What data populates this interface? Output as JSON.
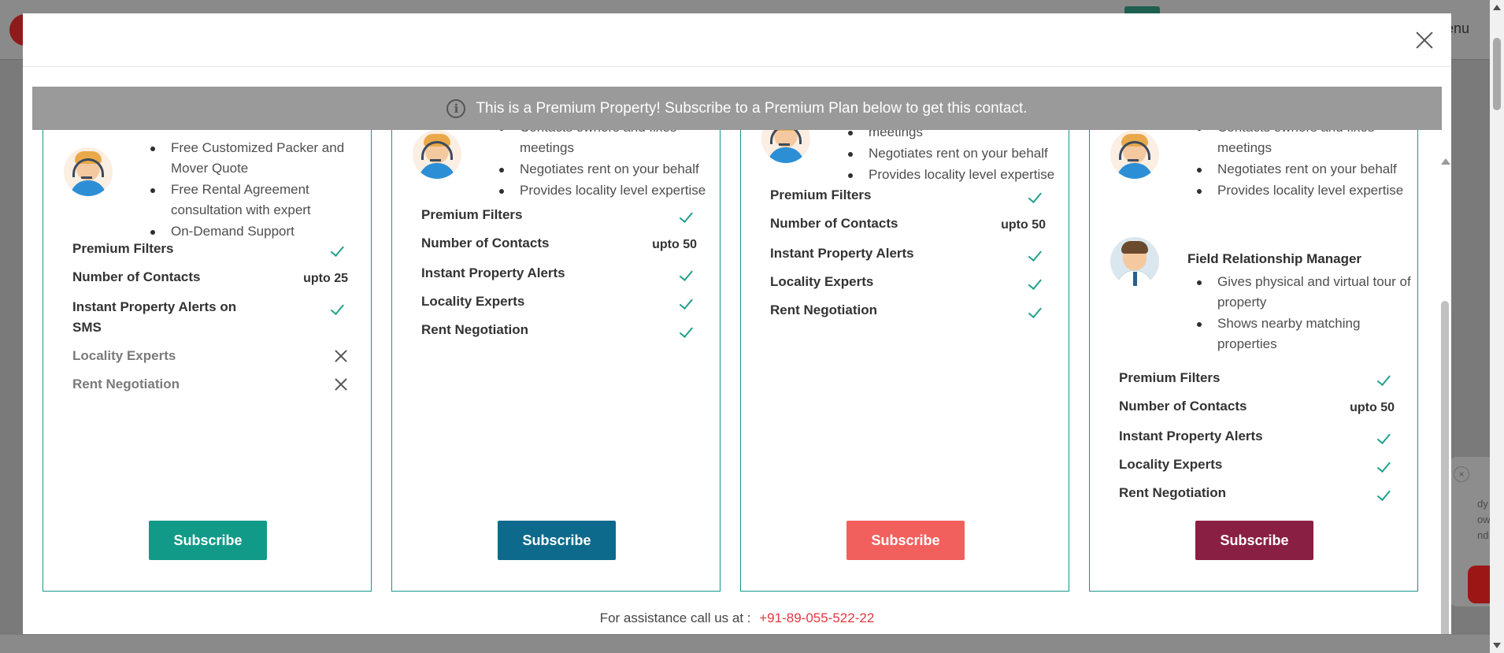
{
  "background": {
    "menu_text": "enu",
    "chat_text": "dy\now\nnd",
    "chat_close": "×"
  },
  "modal": {
    "banner_text": "This is a Premium Property! Subscribe to a Premium Plan below to get this contact.",
    "assistance_label": "For assistance call us at :",
    "assistance_phone": "+91-89-055-522-22"
  },
  "plans": [
    {
      "features": [
        "Free Customized Packer and Mover Quote",
        "Free Rental Agreement consultation with expert",
        "On-Demand Support"
      ],
      "rows": [
        {
          "label": "Premium Filters",
          "status": "check"
        },
        {
          "label": "Number of Contacts",
          "value": "upto 25"
        },
        {
          "label": "Instant Property Alerts on SMS",
          "status": "check"
        },
        {
          "label": "Locality Experts",
          "status": "cross"
        },
        {
          "label": "Rent Negotiation",
          "status": "cross"
        }
      ],
      "button": "Subscribe",
      "color": "#119a88"
    },
    {
      "features": [
        "Contacts owners and fixes meetings",
        "Negotiates rent on your behalf",
        "Provides locality level expertise"
      ],
      "rows": [
        {
          "label": "Premium Filters",
          "status": "check"
        },
        {
          "label": "Number of Contacts",
          "value": "upto 50"
        },
        {
          "label": "Instant Property Alerts",
          "status": "check"
        },
        {
          "label": "Locality Experts",
          "status": "check"
        },
        {
          "label": "Rent Negotiation",
          "status": "check"
        }
      ],
      "button": "Subscribe",
      "color": "#0d6a8c"
    },
    {
      "features": [
        "meetings",
        "Negotiates rent on your behalf",
        "Provides locality level expertise"
      ],
      "rows": [
        {
          "label": "Premium Filters",
          "status": "check"
        },
        {
          "label": "Number of Contacts",
          "value": "upto 50"
        },
        {
          "label": "Instant Property Alerts",
          "status": "check"
        },
        {
          "label": "Locality Experts",
          "status": "check"
        },
        {
          "label": "Rent Negotiation",
          "status": "check"
        }
      ],
      "button": "Subscribe",
      "color": "#f2605d"
    },
    {
      "features": [
        "Contacts owners and fixes meetings",
        "Negotiates rent on your behalf",
        "Provides locality level expertise"
      ],
      "frm_title": "Field Relationship Manager",
      "frm_features": [
        "Gives physical and virtual tour of property",
        "Shows nearby matching properties"
      ],
      "rows": [
        {
          "label": "Premium Filters",
          "status": "check"
        },
        {
          "label": "Number of Contacts",
          "value": "upto 50"
        },
        {
          "label": "Instant Property Alerts",
          "status": "check"
        },
        {
          "label": "Locality Experts",
          "status": "check"
        },
        {
          "label": "Rent Negotiation",
          "status": "check"
        }
      ],
      "button": "Subscribe",
      "color": "#8a1f44"
    }
  ],
  "icons": {
    "close": "close-icon",
    "info": "info-icon",
    "check": "check-icon",
    "cross": "cross-icon",
    "agent_avatar": "relationship-manager-avatar",
    "frm_avatar": "field-manager-avatar"
  }
}
